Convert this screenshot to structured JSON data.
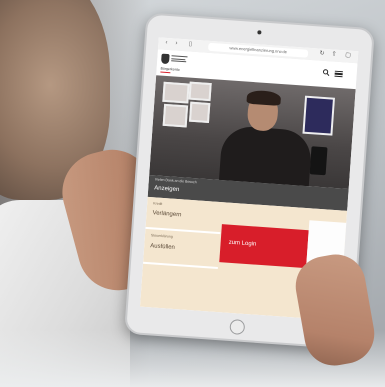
{
  "browser": {
    "url": "www.energiefinanzierung.nrw.de"
  },
  "site": {
    "tag": "Bürgerkonto"
  },
  "hero": {
    "caption": "Vielen Dank an die Besuch",
    "title": "Anzeigen"
  },
  "cards": [
    {
      "label": "Kredit",
      "title": "Verlängern"
    },
    {
      "label": "Steuerklärung",
      "title": "Ausfüllen"
    }
  ],
  "login": {
    "label": "zum Login"
  },
  "colors": {
    "accent_red": "#d81e2a",
    "panel_beige": "#f4e6cf",
    "dark_bar": "#4a4a4a"
  },
  "icons": [
    "search-icon",
    "menu-icon",
    "back-icon",
    "share-icon",
    "logo-icon"
  ]
}
